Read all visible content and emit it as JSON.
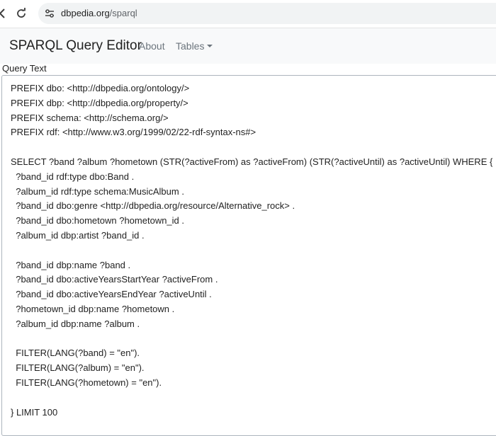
{
  "browser": {
    "url_host": "dbpedia.org",
    "url_path": "/sparql",
    "back_icon": "back-arrow-icon",
    "reload_icon": "reload-icon",
    "site_info_icon": "tune-icon"
  },
  "navbar": {
    "brand": "SPARQL Query Editor",
    "about": "About",
    "tables": "Tables"
  },
  "editor": {
    "label": "Query Text",
    "query_lines": [
      "PREFIX dbo: <http://dbpedia.org/ontology/>",
      "PREFIX dbp: <http://dbpedia.org/property/>",
      "PREFIX schema: <http://schema.org/>",
      "PREFIX rdf: <http://www.w3.org/1999/02/22-rdf-syntax-ns#>",
      "",
      "SELECT ?band ?album ?hometown (STR(?activeFrom) as ?activeFrom) (STR(?activeUntil) as ?activeUntil) WHERE {",
      "  ?band_id rdf:type dbo:Band .",
      "  ?album_id rdf:type schema:MusicAlbum .",
      "  ?band_id dbo:genre <http://dbpedia.org/resource/Alternative_rock> .",
      "  ?band_id dbo:hometown ?hometown_id .",
      "  ?album_id dbp:artist ?band_id .",
      "",
      "  ?band_id dbp:name ?band .",
      "  ?band_id dbo:activeYearsStartYear ?activeFrom .",
      "  ?band_id dbo:activeYearsEndYear ?activeUntil .",
      "  ?hometown_id dbp:name ?hometown .",
      "  ?album_id dbp:name ?album .",
      "",
      "  FILTER(LANG(?band) = \"en\").",
      "  FILTER(LANG(?album) = \"en\").",
      "  FILTER(LANG(?hometown) = \"en\").",
      "",
      "} LIMIT 100"
    ]
  }
}
